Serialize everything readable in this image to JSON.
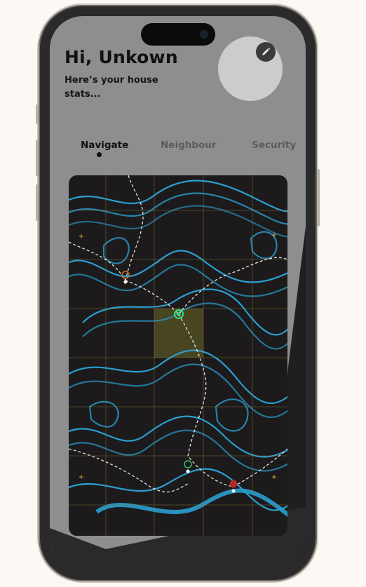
{
  "header": {
    "greeting": "Hi, Unkown",
    "subtitle": "Here’s your house stats..."
  },
  "tabs": [
    {
      "label": "Navigate",
      "active": true
    },
    {
      "label": "Neighbour",
      "active": false
    },
    {
      "label": "Security",
      "active": false
    }
  ],
  "colors": {
    "screen_background": "#8e8e8e",
    "map_background": "#1c1a1b",
    "contour": "#2a9fd0",
    "grid": "#8a7a35",
    "trail": "#e8e6e0",
    "marker_active": "#35e07a",
    "marker_warning": "#d46a24",
    "marker_danger": "#b5282a"
  },
  "icons": {
    "edit": "pencil-icon"
  }
}
